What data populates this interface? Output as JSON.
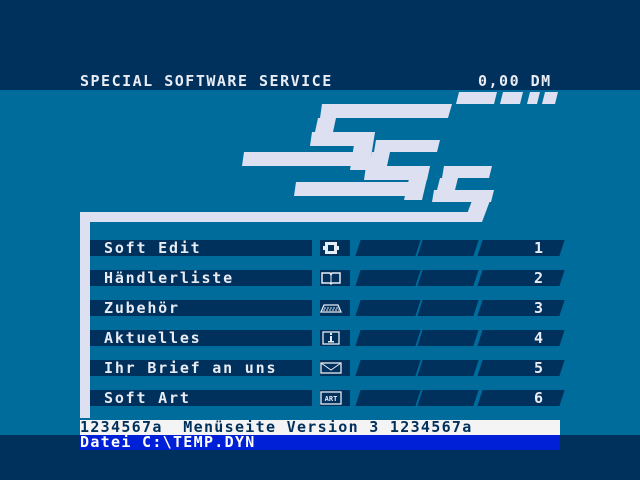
{
  "header": {
    "title": "SPECIAL SOFTWARE SERVICE",
    "price": "0,00 DM"
  },
  "logo": {
    "text": "SSS"
  },
  "menu": {
    "items": [
      {
        "label": "Soft Edit",
        "number": "1",
        "icon": "gear-icon"
      },
      {
        "label": "Händlerliste",
        "number": "2",
        "icon": "book-icon"
      },
      {
        "label": "Zubehör",
        "number": "3",
        "icon": "keyboard-icon"
      },
      {
        "label": "Aktuelles",
        "number": "4",
        "icon": "info-icon"
      },
      {
        "label": "Ihr Brief an uns",
        "number": "5",
        "icon": "envelope-icon"
      },
      {
        "label": "Soft Art",
        "number": "6",
        "icon": "art-icon"
      }
    ]
  },
  "status_bar": {
    "text": "1234567a  Menüseite Version 3 1234567a"
  },
  "file_bar": {
    "text": "Datei C:\\TEMP.DYN"
  },
  "colors": {
    "background": "#00305c",
    "band": "#006c9c",
    "text": "#e8ecf4",
    "status_bg": "#f4f4f4",
    "file_bg": "#0020d8"
  }
}
